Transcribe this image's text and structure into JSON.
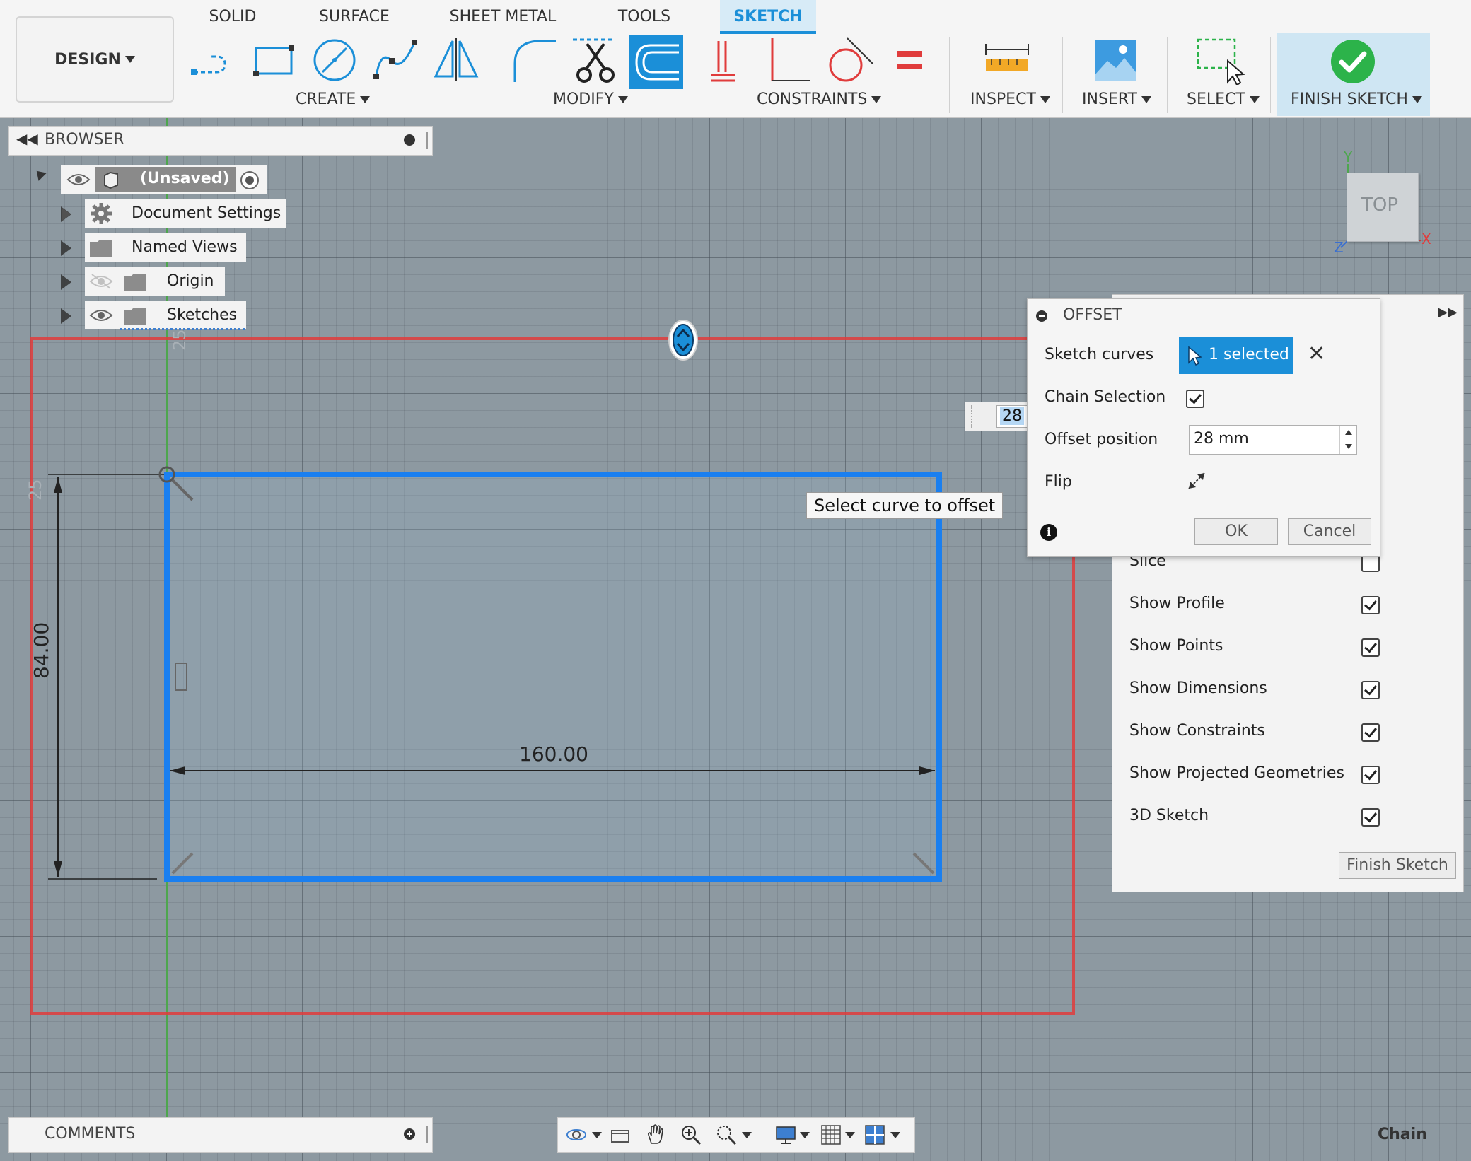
{
  "toolbar": {
    "design_label": "DESIGN",
    "tabs": [
      {
        "label": "SOLID"
      },
      {
        "label": "SURFACE"
      },
      {
        "label": "SHEET METAL"
      },
      {
        "label": "TOOLS"
      },
      {
        "label": "SKETCH",
        "active": true
      }
    ],
    "groups": {
      "create": "CREATE",
      "modify": "MODIFY",
      "constraints": "CONSTRAINTS",
      "inspect": "INSPECT",
      "insert": "INSERT",
      "select": "SELECT",
      "finish": "FINISH SKETCH"
    }
  },
  "browser": {
    "title": "BROWSER",
    "root": "(Unsaved)",
    "items": [
      {
        "label": "Document Settings",
        "icon": "gear-icon"
      },
      {
        "label": "Named Views",
        "icon": "folder-icon"
      },
      {
        "label": "Origin",
        "icon": "folder-icon"
      },
      {
        "label": "Sketches",
        "icon": "folder-icon"
      }
    ]
  },
  "sketch": {
    "width_dim": "160.00",
    "height_dim": "84.00",
    "offset_ghost_1": "25",
    "offset_ghost_2": "25",
    "tooltip": "Select curve to offset",
    "inline_value": "28"
  },
  "viewcube": {
    "face": "TOP",
    "axis_x": "X",
    "axis_y": "Y",
    "axis_z": "Z"
  },
  "offset_dialog": {
    "title": "OFFSET",
    "sketch_curves_label": "Sketch curves",
    "selected_label": "1 selected",
    "chain_label": "Chain Selection",
    "chain_checked": true,
    "position_label": "Offset position",
    "position_value": "28 mm",
    "flip_label": "Flip",
    "ok": "OK",
    "cancel": "Cancel"
  },
  "palette": {
    "items": [
      {
        "label": "Slice",
        "checked": false
      },
      {
        "label": "Show Profile",
        "checked": true
      },
      {
        "label": "Show Points",
        "checked": true
      },
      {
        "label": "Show Dimensions",
        "checked": true
      },
      {
        "label": "Show Constraints",
        "checked": true
      },
      {
        "label": "Show Projected Geometries",
        "checked": true
      },
      {
        "label": "3D Sketch",
        "checked": true
      }
    ],
    "finish_button": "Finish Sketch"
  },
  "comments": {
    "title": "COMMENTS"
  },
  "status": {
    "chain": "Chain"
  },
  "colors": {
    "accent": "#1b8fd8",
    "sketch_blue": "#1a7ff0",
    "offset_red": "#e03c3c",
    "finish_green": "#2cb34a"
  }
}
